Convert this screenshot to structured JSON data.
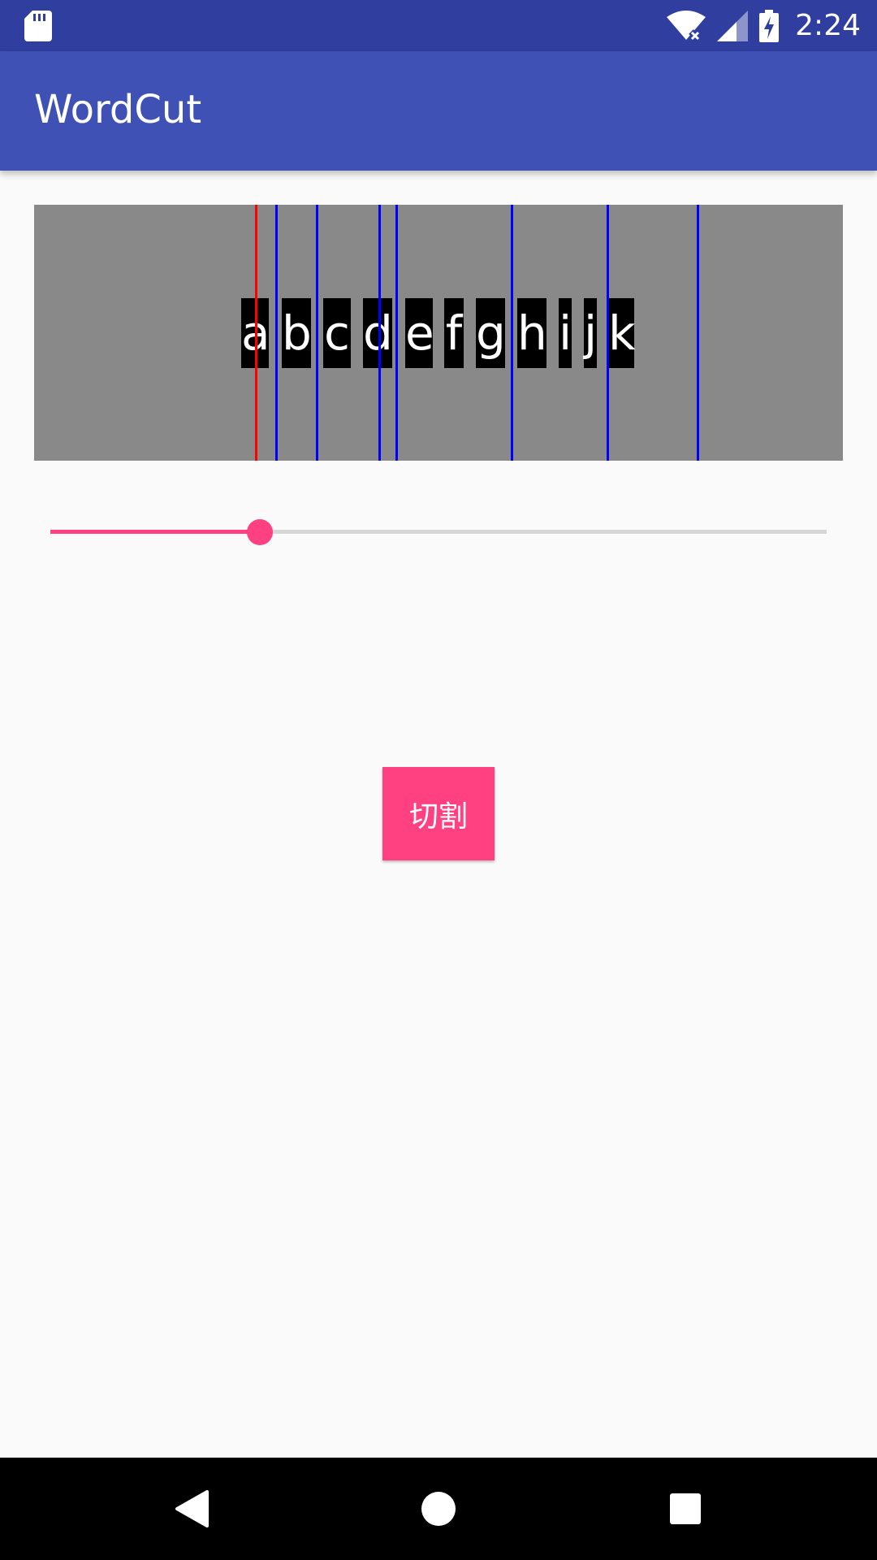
{
  "status_bar": {
    "time": "2:24",
    "icons": [
      "sd-card-icon",
      "wifi-no-internet-icon",
      "cell-signal-icon",
      "battery-charging-icon"
    ],
    "background": "#303f9f"
  },
  "app_bar": {
    "title": "WordCut",
    "background": "#3f51b5"
  },
  "image_panel": {
    "background": "#898989",
    "letters": [
      "a",
      "b",
      "c",
      "d",
      "e",
      "f",
      "g",
      "h",
      "i",
      "j",
      "k"
    ],
    "cut_line_colors": {
      "selected": "#ff0000",
      "others": "#0000ff"
    }
  },
  "slider": {
    "value_fraction": 0.27,
    "accent": "#ff4081",
    "track": "#d6d6d6"
  },
  "cut_button": {
    "label": "切割",
    "background": "#ff4081"
  },
  "nav_bar": {
    "icons": [
      "back-icon",
      "home-icon",
      "recents-icon"
    ]
  }
}
